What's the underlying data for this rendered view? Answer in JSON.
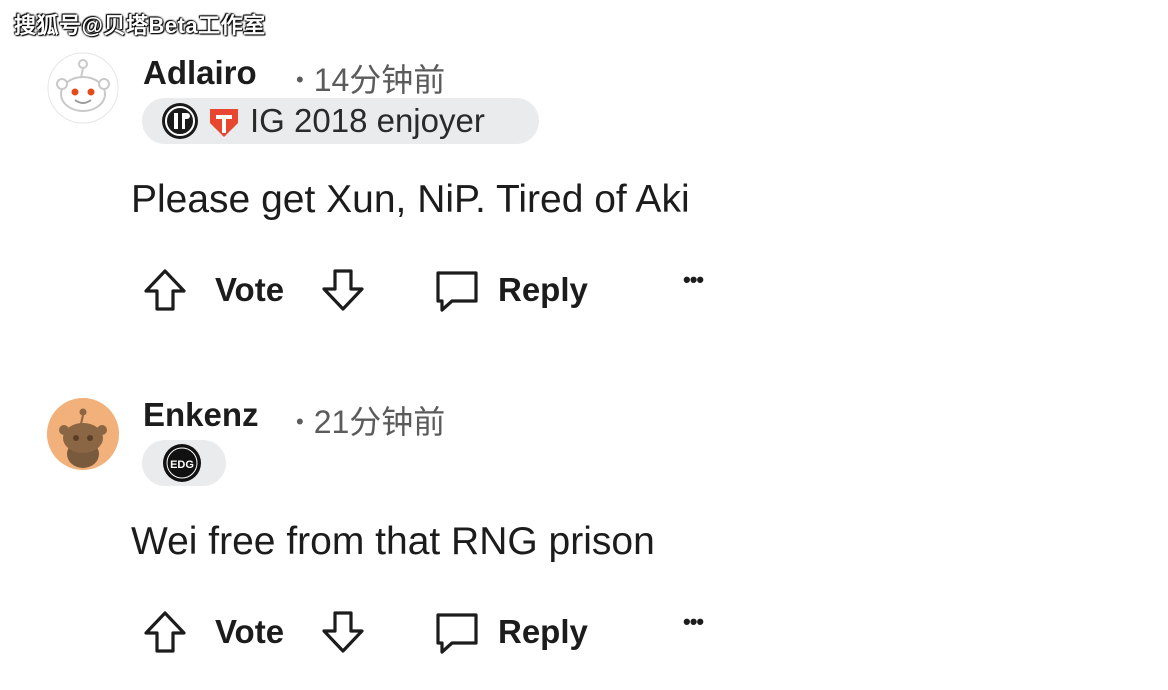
{
  "watermark": "搜狐号@贝塔Beta工作室",
  "comments": [
    {
      "username": "Adlairo",
      "time": "14分钟前",
      "flair_text": "IG 2018 enjoyer",
      "body": "Please get Xun, NiP. Tired of Aki",
      "vote_label": "Vote",
      "reply_label": "Reply",
      "more": "•••",
      "avatar_icon": "snoo-avatar-icon",
      "flair_icons": [
        "ig-team-icon",
        "tes-team-icon"
      ]
    },
    {
      "username": "Enkenz",
      "time": "21分钟前",
      "flair_text": "",
      "body": "Wei free from that RNG prison",
      "vote_label": "Vote",
      "reply_label": "Reply",
      "more": "•••",
      "avatar_icon": "snoo-avatar-icon",
      "flair_icons": [
        "edg-team-icon"
      ]
    }
  ],
  "colors": {
    "text": "#1c1c1c",
    "meta": "#5b5b5b",
    "flair_bg": "#e9ebed",
    "avatar2_bg": "#f2b07a"
  }
}
